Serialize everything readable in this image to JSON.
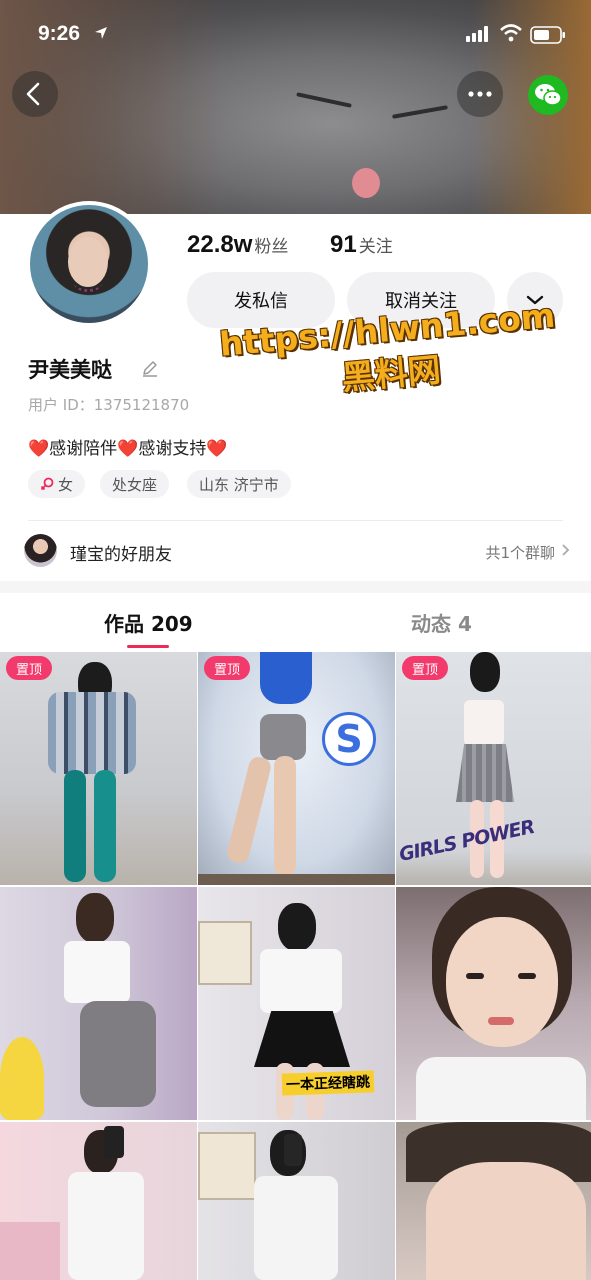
{
  "status_bar": {
    "time": "9:26"
  },
  "profile": {
    "name": "尹美美哒",
    "user_id": "用户 ID：1375121870",
    "followers_count": "22.8w",
    "followers_label": "粉丝",
    "following_count": "91",
    "following_label": "关注",
    "bio": "❤️感谢陪伴❤️感谢支持❤️",
    "tags": [
      "女",
      "处女座",
      "山东 济宁市"
    ]
  },
  "actions": {
    "message_label": "发私信",
    "unfollow_label": "取消关注"
  },
  "watermark": {
    "line1": "https://hlwn1.com",
    "line2": "黑料网"
  },
  "group_chat": {
    "name": "瑾宝的好朋友",
    "count_label": "共1个群聊"
  },
  "tabs": [
    {
      "label": "作品 209",
      "active": true
    },
    {
      "label": "动态 4",
      "active": false
    }
  ],
  "pin_label": "置顶",
  "video_stickers": {
    "cell5": "一本正经瞎跳",
    "cell2_letter": "S",
    "cell3_text": "GIRLS POWER"
  },
  "colors": {
    "accent": "#f0295a",
    "pin_badge": "#f23a6c",
    "wechat_green": "#1fb922",
    "watermark": "#f4ad1c"
  },
  "icons": [
    "back-icon",
    "more-icon",
    "wechat-icon",
    "chevron-down-icon",
    "edit-icon",
    "female-icon",
    "chevron-right-icon"
  ]
}
